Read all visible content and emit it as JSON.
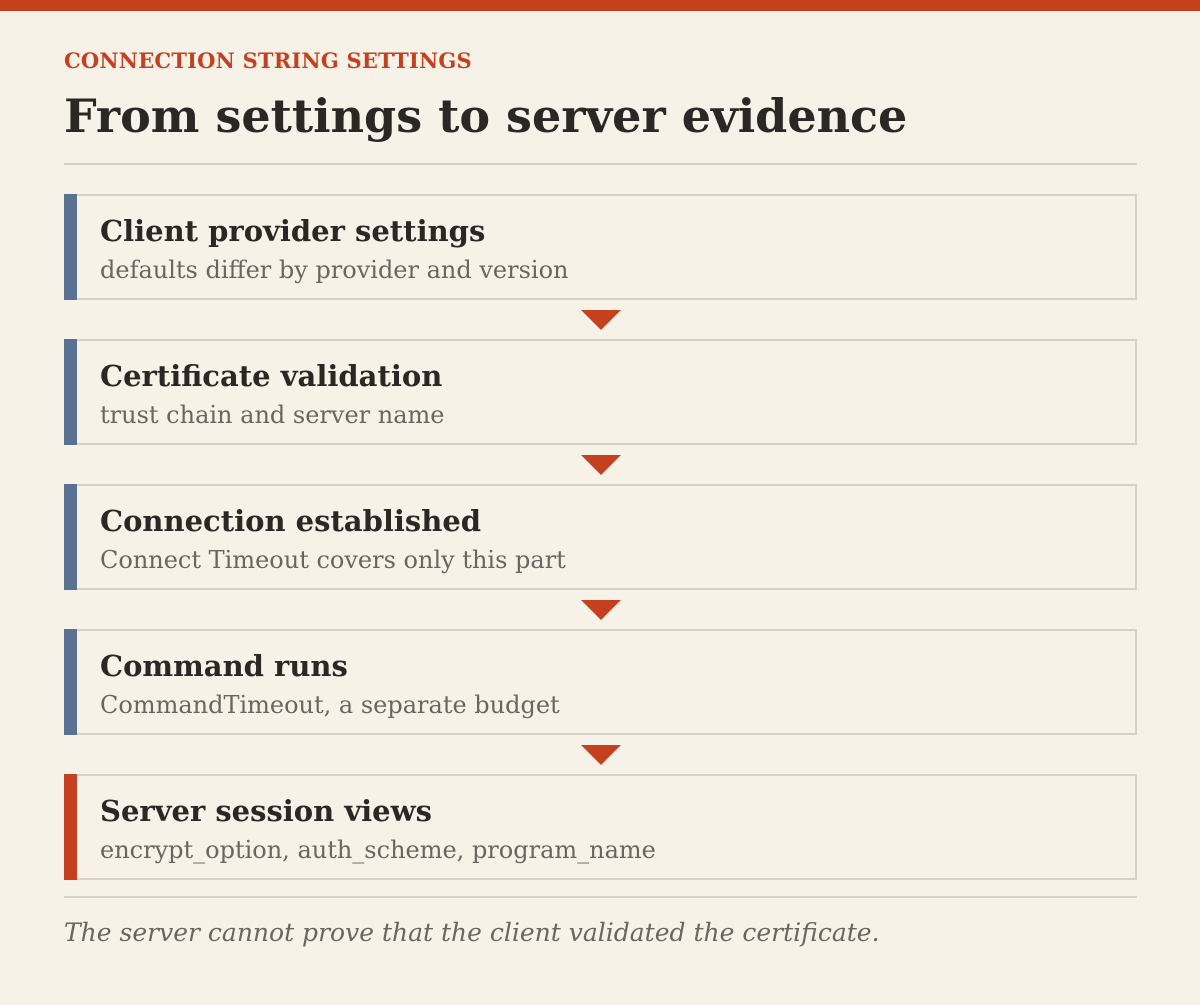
{
  "header": {
    "eyebrow": "CONNECTION STRING SETTINGS",
    "title": "From settings to server evidence"
  },
  "colors": {
    "accent": "#c4401f",
    "step_bar": "#5a7191",
    "background": "#f7f2e8"
  },
  "steps": [
    {
      "label": "Client provider settings",
      "desc": "defaults differ by provider and version"
    },
    {
      "label": "Certificate validation",
      "desc": "trust chain and server name"
    },
    {
      "label": "Connection established",
      "desc": "Connect Timeout covers only this part"
    },
    {
      "label": "Command runs",
      "desc": "CommandTimeout, a separate budget"
    },
    {
      "label": "Server session views",
      "desc": "encrypt_option, auth_scheme, program_name"
    }
  ],
  "caption": "The server cannot prove that the client validated the certificate."
}
